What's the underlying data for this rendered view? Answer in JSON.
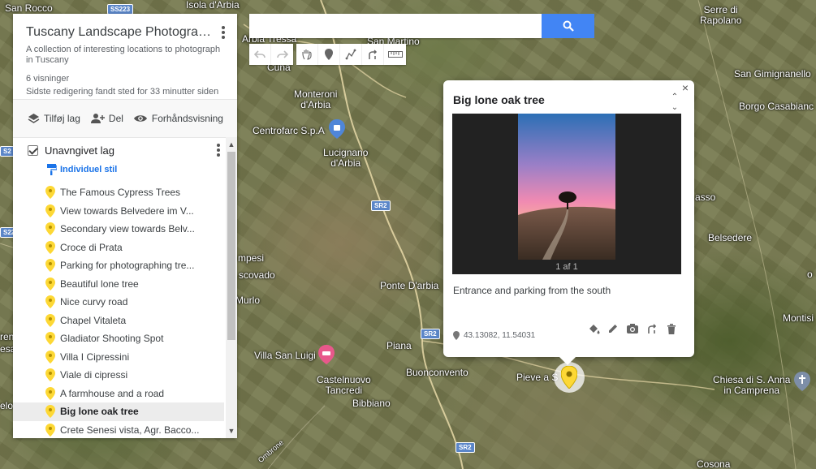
{
  "search": {
    "placeholder": "",
    "value": ""
  },
  "toolbar": {
    "undo_icon": "undo-icon",
    "redo_icon": "redo-icon",
    "select_icon": "hand-icon",
    "marker_icon": "marker-icon",
    "line_icon": "draw-line-icon",
    "directions_icon": "directions-icon",
    "measure_icon": "ruler-icon"
  },
  "map_panel": {
    "title": "Tuscany Landscape Photography ...",
    "description": "A collection of interesting locations to photograph in Tuscany",
    "views": "6 visninger",
    "last_edit": "Sidste redigering fandt sted for 33 minutter siden",
    "actions": {
      "add_layer": "Tilføj lag",
      "share": "Del",
      "preview": "Forhåndsvisning"
    },
    "layer": {
      "name": "Unavngivet lag",
      "style_link": "Individuel stil",
      "items": [
        {
          "label": "The Famous Cypress Trees",
          "selected": false
        },
        {
          "label": "View towards Belvedere im V...",
          "selected": false
        },
        {
          "label": "Secondary view towards Belv...",
          "selected": false
        },
        {
          "label": "Croce di Prata",
          "selected": false
        },
        {
          "label": "Parking for photographing tre...",
          "selected": false
        },
        {
          "label": "Beautiful lone tree",
          "selected": false
        },
        {
          "label": "Nice curvy road",
          "selected": false
        },
        {
          "label": "Chapel Vitaleta",
          "selected": false
        },
        {
          "label": "Gladiator Shooting Spot",
          "selected": false
        },
        {
          "label": "Villa I Cipressini",
          "selected": false
        },
        {
          "label": "Viale di cipressi",
          "selected": false
        },
        {
          "label": "A farmhouse and a road",
          "selected": false
        },
        {
          "label": "Big lone oak tree",
          "selected": true
        },
        {
          "label": "Crete Senesi vista, Agr. Bacco...",
          "selected": false
        }
      ]
    }
  },
  "popup": {
    "title": "Big lone oak tree",
    "photo_count": "1 af 1",
    "description": "Entrance and parking from the south",
    "coordinates": "43.13082, 11.54031"
  },
  "map_labels": {
    "san_rocco": "San Rocco",
    "isola_darbia": "Isola d'Arbia",
    "arbia_tressa": "Arbia Tressa",
    "san_martino": "San Martino",
    "cuna": "Cuna",
    "serre_rapolano": "Serre di\nRapolano",
    "san_gimignanello": "San Gimignanello",
    "borgo_casabianca": "Borgo Casabianc",
    "monteroni": "Monteroni\nd'Arbia",
    "centrofarc": "Centrofarc S.p.A",
    "lucignano": "Lucignano\nd'Arbia",
    "asso": "asso",
    "belsedere": "Belsedere",
    "ampesi": "mpesi",
    "scovado": "scovado",
    "ponte_arbia": "Ponte D'arbia",
    "murlo": "Murlo",
    "montisi": "Montisi",
    "piana": "Piana",
    "villa_san_luigi": "Villa San Luigi",
    "buonconvento": "Buonconvento",
    "pieve": "Pieve a S",
    "castelnuovo": "Castelnuovo\nTancredi",
    "bibbiano": "Bibbiano",
    "chiesa_anna": "Chiesa di S. Anna\nin Camprena",
    "cosona": "Cosona",
    "ombrone": "Ombrone",
    "ren": "ren",
    "esa": "esa",
    "elo": "elo",
    "o_right": "o",
    "ss223": "SS223",
    "sr2_a": "SR2",
    "sr2_b": "SR2",
    "sr2_c": "SR2",
    "s2_left": "S2",
    "s22_left": "S22"
  },
  "colors": {
    "accent": "#4285f4",
    "link": "#1a73e8",
    "marker": "#fdd835",
    "poi_pink": "#e8588b",
    "poi_blue": "#4f86d8"
  }
}
